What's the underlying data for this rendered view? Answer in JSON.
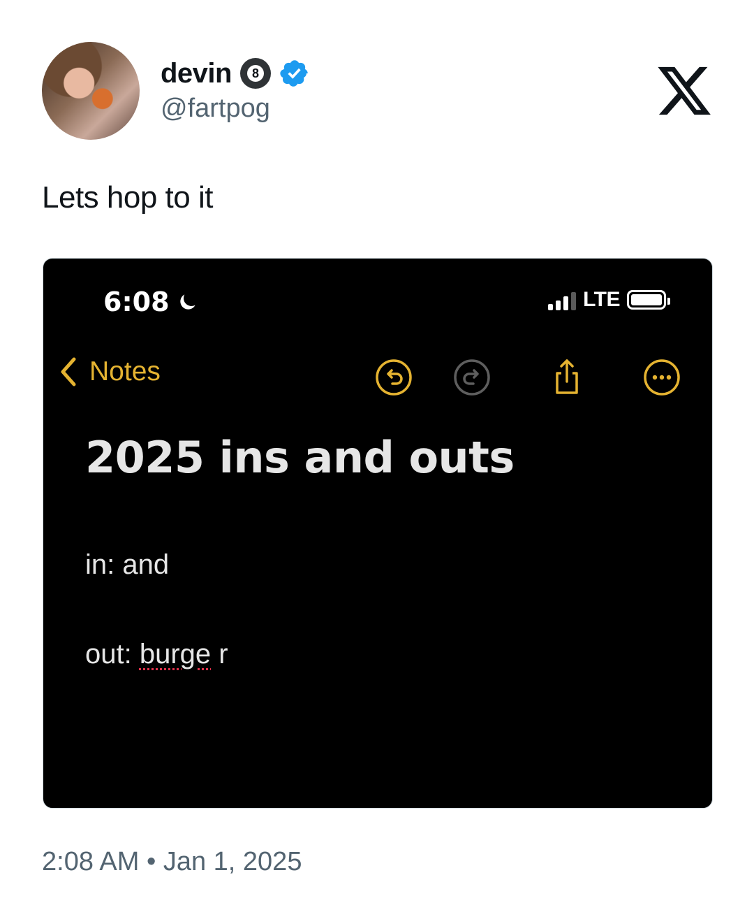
{
  "author": {
    "name": "devin",
    "badge_number": "8",
    "handle": "@fartpog",
    "verified": true
  },
  "tweet": {
    "text": "Lets hop to it",
    "timestamp": "2:08 AM • Jan 1, 2025"
  },
  "screenshot": {
    "status_bar": {
      "time": "6:08",
      "network": "LTE",
      "icons": [
        "moon-icon",
        "signal-icon",
        "battery-icon"
      ]
    },
    "nav": {
      "back_label": "Notes",
      "tools": [
        "undo-icon",
        "redo-icon",
        "share-icon",
        "more-icon"
      ]
    },
    "note": {
      "title": "2025 ins and outs",
      "line1": "in: and",
      "line2_prefix": "out: ",
      "line2_misspelled": "burge",
      "line2_suffix": " r"
    }
  },
  "colors": {
    "accent_yellow": "#e5b331",
    "verified_blue": "#1d9bf0",
    "muted_text": "#536471"
  }
}
